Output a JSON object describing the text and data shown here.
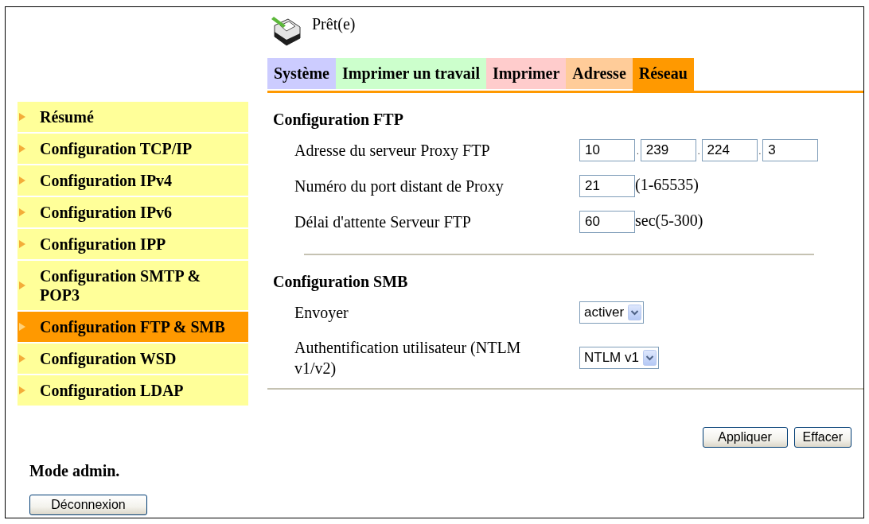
{
  "status": {
    "text": "Prêt(e)"
  },
  "tabs": [
    {
      "label": "Système",
      "color": "#ccccff",
      "selected": false
    },
    {
      "label": "Imprimer un travail",
      "color": "#ccffcc",
      "selected": false
    },
    {
      "label": "Imprimer",
      "color": "#ffcccc",
      "selected": false
    },
    {
      "label": "Adresse",
      "color": "#ffcc99",
      "selected": false
    },
    {
      "label": "Réseau",
      "color": "#ff9900",
      "selected": true
    }
  ],
  "sidebar": {
    "items": [
      {
        "label": "Résumé",
        "selected": false
      },
      {
        "label": "Configuration TCP/IP",
        "selected": false
      },
      {
        "label": "Configuration IPv4",
        "selected": false
      },
      {
        "label": "Configuration IPv6",
        "selected": false
      },
      {
        "label": "Configuration IPP",
        "selected": false
      },
      {
        "label": "Configuration SMTP & POP3",
        "selected": false
      },
      {
        "label": "Configuration FTP & SMB",
        "selected": true
      },
      {
        "label": "Configuration WSD",
        "selected": false
      },
      {
        "label": "Configuration LDAP",
        "selected": false
      }
    ]
  },
  "admin": {
    "label": "Mode admin.",
    "logout_button": "Déconnexion"
  },
  "sections": [
    {
      "title": "Configuration FTP",
      "rows": [
        {
          "kind": "ip",
          "label": "Adresse du serveur Proxy FTP",
          "fields": [
            {
              "value": "10"
            },
            {
              "separator": ".",
              "value": "239"
            },
            {
              "separator": ".",
              "value": "224"
            },
            {
              "separator": ".",
              "value": "3"
            }
          ]
        },
        {
          "kind": "number",
          "label": "Numéro du port distant de Proxy",
          "value": "21",
          "suffix": "(1-65535)"
        },
        {
          "kind": "number",
          "label": "Délai d'attente Serveur FTP",
          "value": "60",
          "suffix": "sec(5-300)"
        }
      ]
    },
    {
      "title": "Configuration SMB",
      "rows": [
        {
          "kind": "select",
          "label": "Envoyer",
          "value": "activer"
        },
        {
          "kind": "select",
          "label": "Authentification utilisateur (NTLM v1/v2)",
          "value": "NTLM v1"
        }
      ]
    }
  ],
  "buttons": [
    "Appliquer",
    "Effacer"
  ]
}
